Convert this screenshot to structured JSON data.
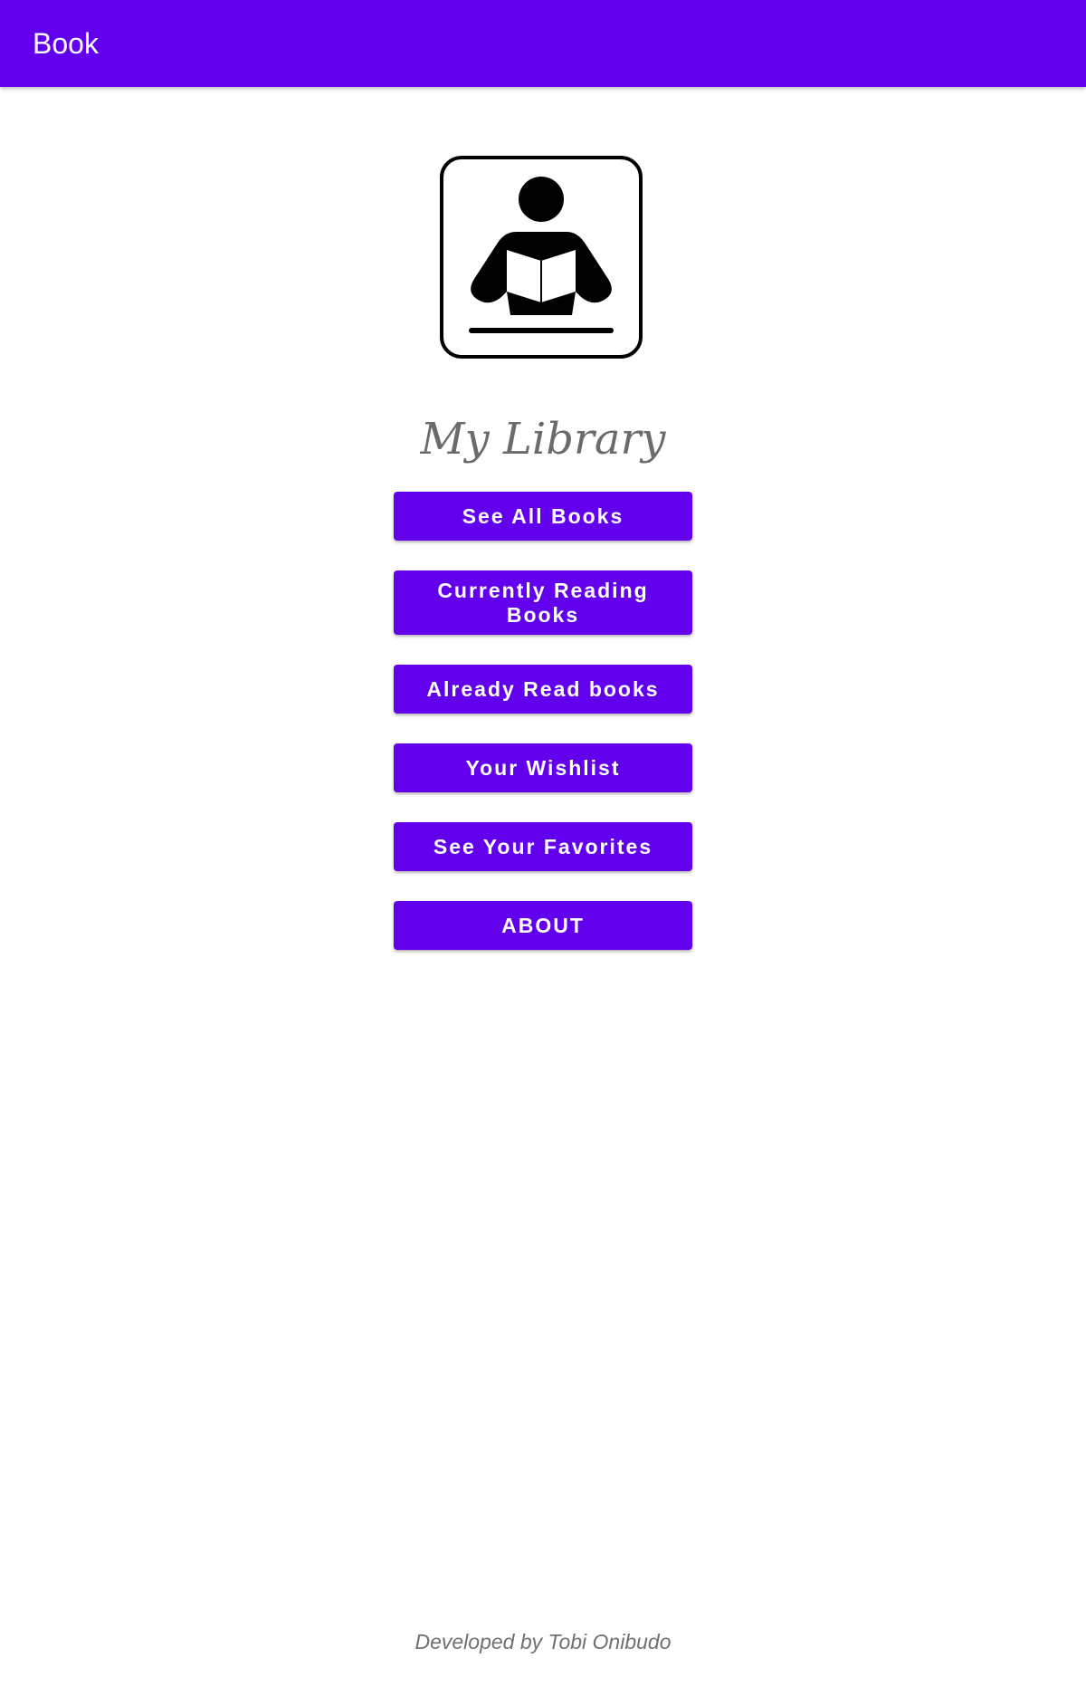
{
  "app_bar": {
    "title": "Book",
    "color": "#6200EE"
  },
  "logo": {
    "icon": "reading-person-icon"
  },
  "main": {
    "title": "My Library",
    "buttons": [
      {
        "label": "See All Books"
      },
      {
        "label": "Currently Reading Books"
      },
      {
        "label": "Already Read books"
      },
      {
        "label": "Your Wishlist"
      },
      {
        "label": "See Your Favorites"
      },
      {
        "label": "ABOUT"
      }
    ]
  },
  "footer": {
    "text": "Developed by Tobi Onibudo"
  }
}
